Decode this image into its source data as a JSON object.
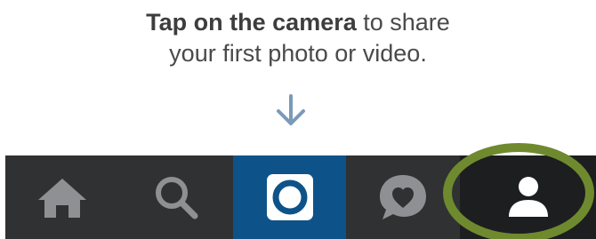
{
  "prompt": {
    "bold": "Tap on the camera",
    "line1_rest": " to share",
    "line2": "your first photo or video."
  },
  "icons": {
    "arrow": "arrow-down-icon",
    "home": "home-icon",
    "search": "search-icon",
    "camera": "camera-icon",
    "activity": "heart-bubble-icon",
    "profile": "person-icon"
  },
  "colors": {
    "prompt_text": "#4a4a4a",
    "arrow": "#7a9ab8",
    "tabbar": "#2f3133",
    "camera_tab": "#0d5389",
    "profile_tab": "#1d1e20",
    "icon_inactive": "#8e9093",
    "highlight_ring": "#6f8a2e"
  }
}
